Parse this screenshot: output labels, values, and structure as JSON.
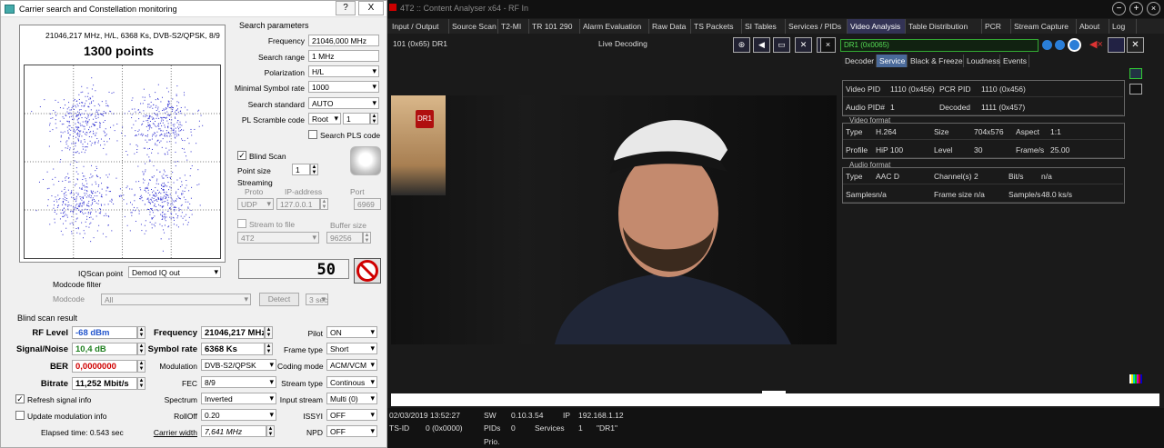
{
  "dialog": {
    "title": "Carrier search and Constellation monitoring",
    "help": "?",
    "close": "X",
    "constellation": {
      "header": "21046,217 MHz, H/L, 6368 Ks, DVB-S2/QPSK, 8/9",
      "points_label": "1300 points",
      "points_count": 1300
    },
    "search_params": {
      "section": "Search parameters",
      "frequency_label": "Frequency",
      "frequency_value": "21046,000 MHz",
      "range_label": "Search range",
      "range_value": "1 MHz",
      "polarization_label": "Polarization",
      "polarization_value": "H/L",
      "min_sr_label": "Minimal Symbol rate",
      "min_sr_value": "1000",
      "standard_label": "Search standard",
      "standard_value": "AUTO",
      "pls_label": "PL Scramble code",
      "pls_mode": "Root",
      "pls_value": "1",
      "search_pls_label": "Search PLS code"
    },
    "blind_scan_label": "Blind Scan",
    "point_size_label": "Point size",
    "point_size_value": "1",
    "streaming": {
      "label": "Streaming",
      "proto_label": "Proto",
      "ip_label": "IP-address",
      "port_label": "Port",
      "proto_value": "UDP",
      "ip_value": "127.0.0.1",
      "port_value": "6969",
      "stream_to_file_label": "Stream to file",
      "buffer_size_label": "Buffer size",
      "file_value": "4T2",
      "buffer_value": "96256"
    },
    "counter_value": "50",
    "iq_point_label": "IQScan point",
    "iq_point_value": "Demod IQ out",
    "modcode_filter_label": "Modcode filter",
    "modcode_label": "Modcode",
    "modcode_value": "All",
    "detect_label": "Detect",
    "detect_time": "3 sec",
    "result": {
      "section": "Blind scan result",
      "rf_level_label": "RF Level",
      "rf_level_value": "-68 dBm",
      "snr_label": "Signal/Noise",
      "snr_value": "10,4 dB",
      "ber_label": "BER",
      "ber_value": "0,0000000",
      "bitrate_label": "Bitrate",
      "bitrate_value": "11,252 Mbit/s",
      "frequency_label": "Frequency",
      "frequency_value": "21046,217 MHz",
      "symbol_rate_label": "Symbol rate",
      "symbol_rate_value": "6368 Ks",
      "modulation_label": "Modulation",
      "modulation_value": "DVB-S2/QPSK",
      "fec_label": "FEC",
      "fec_value": "8/9",
      "spectrum_label": "Spectrum",
      "spectrum_value": "Inverted",
      "rolloff_label": "RollOff",
      "rolloff_value": "0.20",
      "carrier_width_label": "Carrier width",
      "carrier_width_value": "7,641 MHz",
      "pilot_label": "Pilot",
      "pilot_value": "ON",
      "frame_type_label": "Frame type",
      "frame_type_value": "Short",
      "coding_mode_label": "Coding mode",
      "coding_mode_value": "ACM/VCM",
      "stream_type_label": "Stream type",
      "stream_type_value": "Continous",
      "input_stream_label": "Input stream",
      "input_stream_value": "Multi (0)",
      "issyi_label": "ISSYI",
      "issyi_value": "OFF",
      "npd_label": "NPD",
      "npd_value": "OFF"
    },
    "refresh_label": "Refresh signal info",
    "update_mod_label": "Update modulation info",
    "elapsed_label": "Elapsed time: 0.543 sec"
  },
  "app": {
    "title": "4T2 :: Content Analyser x64 - RF In",
    "tabs": [
      "Input / Output",
      "Source Scan",
      "T2-MI",
      "TR 101 290",
      "Alarm Evaluation",
      "Raw Data",
      "TS Packets",
      "SI Tables",
      "Services / PIDs",
      "Video Analysis",
      "Table Distribution",
      "PCR",
      "Stream Capture",
      "About",
      "Log"
    ],
    "active_tab": "Video Analysis",
    "service_label": "101 (0x65) DR1",
    "live_label": "Live Decoding",
    "channel_field": "DR1 (0x0065)",
    "subtabs": [
      "Decoder",
      "Service",
      "Black & Freeze",
      "Loudness",
      "Events"
    ],
    "active_subtab": "Service",
    "service": {
      "video_pid_label": "Video PID",
      "video_pid_value": "1110 (0x456)",
      "pcr_pid_label": "PCR PID",
      "pcr_pid_value": "1110 (0x456)",
      "audio_pid_label": "Audio PID#",
      "audio_pid_value": "1",
      "decoded_label": "Decoded",
      "decoded_value": "1111 (0x457)"
    },
    "video_format": {
      "section": "Video format",
      "type_label": "Type",
      "type_value": "H.264",
      "size_label": "Size",
      "size_value": "704x576",
      "aspect_label": "Aspect",
      "aspect_value": "1:1",
      "profile_label": "Profile",
      "profile_value": "HiP 100",
      "level_label": "Level",
      "level_value": "30",
      "fps_label": "Frame/s",
      "fps_value": "25.00"
    },
    "audio_format": {
      "section": "Audio format",
      "type_label": "Type",
      "type_value": "AAC D",
      "channels_label": "Channel(s)",
      "channels_value": "2",
      "bits_label": "Bit/s",
      "bits_value": "n/a",
      "samples_label": "Samples",
      "samples_value": "n/a",
      "frame_size_label": "Frame size",
      "frame_size_value": "n/a",
      "samples_s_label": "Sample/s",
      "samples_s_value": "48.0 ks/s"
    },
    "status": {
      "datetime": "02/03/2019 13:52:27",
      "sw_label": "SW",
      "sw_value": "0.10.3.54",
      "ip_label": "IP",
      "ip_value": "192.168.1.12",
      "tsid_label": "TS-ID",
      "tsid_value": "0 (0x0000)",
      "pids_label": "PIDs",
      "pids_value": "0",
      "services_label": "Services",
      "services_value": "1",
      "service_name": "\"DR1\"",
      "prio_label": "Prio."
    },
    "logo_text": "DR1"
  }
}
